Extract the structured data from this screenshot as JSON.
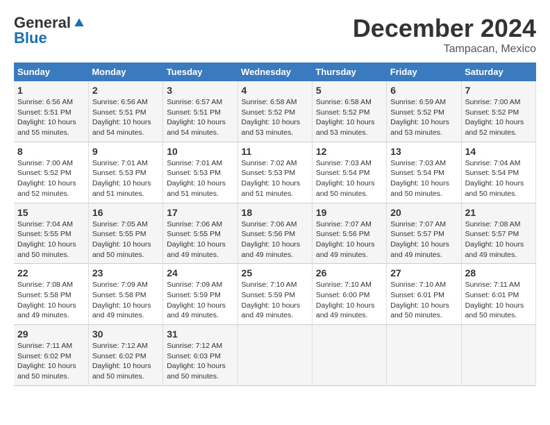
{
  "logo": {
    "general": "General",
    "blue": "Blue"
  },
  "title": {
    "month": "December 2024",
    "location": "Tampacan, Mexico"
  },
  "days_of_week": [
    "Sunday",
    "Monday",
    "Tuesday",
    "Wednesday",
    "Thursday",
    "Friday",
    "Saturday"
  ],
  "weeks": [
    [
      {
        "day": "1",
        "sunrise": "Sunrise: 6:56 AM",
        "sunset": "Sunset: 5:51 PM",
        "daylight": "Daylight: 10 hours and 55 minutes."
      },
      {
        "day": "2",
        "sunrise": "Sunrise: 6:56 AM",
        "sunset": "Sunset: 5:51 PM",
        "daylight": "Daylight: 10 hours and 54 minutes."
      },
      {
        "day": "3",
        "sunrise": "Sunrise: 6:57 AM",
        "sunset": "Sunset: 5:51 PM",
        "daylight": "Daylight: 10 hours and 54 minutes."
      },
      {
        "day": "4",
        "sunrise": "Sunrise: 6:58 AM",
        "sunset": "Sunset: 5:52 PM",
        "daylight": "Daylight: 10 hours and 53 minutes."
      },
      {
        "day": "5",
        "sunrise": "Sunrise: 6:58 AM",
        "sunset": "Sunset: 5:52 PM",
        "daylight": "Daylight: 10 hours and 53 minutes."
      },
      {
        "day": "6",
        "sunrise": "Sunrise: 6:59 AM",
        "sunset": "Sunset: 5:52 PM",
        "daylight": "Daylight: 10 hours and 53 minutes."
      },
      {
        "day": "7",
        "sunrise": "Sunrise: 7:00 AM",
        "sunset": "Sunset: 5:52 PM",
        "daylight": "Daylight: 10 hours and 52 minutes."
      }
    ],
    [
      {
        "day": "8",
        "sunrise": "Sunrise: 7:00 AM",
        "sunset": "Sunset: 5:52 PM",
        "daylight": "Daylight: 10 hours and 52 minutes."
      },
      {
        "day": "9",
        "sunrise": "Sunrise: 7:01 AM",
        "sunset": "Sunset: 5:53 PM",
        "daylight": "Daylight: 10 hours and 51 minutes."
      },
      {
        "day": "10",
        "sunrise": "Sunrise: 7:01 AM",
        "sunset": "Sunset: 5:53 PM",
        "daylight": "Daylight: 10 hours and 51 minutes."
      },
      {
        "day": "11",
        "sunrise": "Sunrise: 7:02 AM",
        "sunset": "Sunset: 5:53 PM",
        "daylight": "Daylight: 10 hours and 51 minutes."
      },
      {
        "day": "12",
        "sunrise": "Sunrise: 7:03 AM",
        "sunset": "Sunset: 5:54 PM",
        "daylight": "Daylight: 10 hours and 50 minutes."
      },
      {
        "day": "13",
        "sunrise": "Sunrise: 7:03 AM",
        "sunset": "Sunset: 5:54 PM",
        "daylight": "Daylight: 10 hours and 50 minutes."
      },
      {
        "day": "14",
        "sunrise": "Sunrise: 7:04 AM",
        "sunset": "Sunset: 5:54 PM",
        "daylight": "Daylight: 10 hours and 50 minutes."
      }
    ],
    [
      {
        "day": "15",
        "sunrise": "Sunrise: 7:04 AM",
        "sunset": "Sunset: 5:55 PM",
        "daylight": "Daylight: 10 hours and 50 minutes."
      },
      {
        "day": "16",
        "sunrise": "Sunrise: 7:05 AM",
        "sunset": "Sunset: 5:55 PM",
        "daylight": "Daylight: 10 hours and 50 minutes."
      },
      {
        "day": "17",
        "sunrise": "Sunrise: 7:06 AM",
        "sunset": "Sunset: 5:55 PM",
        "daylight": "Daylight: 10 hours and 49 minutes."
      },
      {
        "day": "18",
        "sunrise": "Sunrise: 7:06 AM",
        "sunset": "Sunset: 5:56 PM",
        "daylight": "Daylight: 10 hours and 49 minutes."
      },
      {
        "day": "19",
        "sunrise": "Sunrise: 7:07 AM",
        "sunset": "Sunset: 5:56 PM",
        "daylight": "Daylight: 10 hours and 49 minutes."
      },
      {
        "day": "20",
        "sunrise": "Sunrise: 7:07 AM",
        "sunset": "Sunset: 5:57 PM",
        "daylight": "Daylight: 10 hours and 49 minutes."
      },
      {
        "day": "21",
        "sunrise": "Sunrise: 7:08 AM",
        "sunset": "Sunset: 5:57 PM",
        "daylight": "Daylight: 10 hours and 49 minutes."
      }
    ],
    [
      {
        "day": "22",
        "sunrise": "Sunrise: 7:08 AM",
        "sunset": "Sunset: 5:58 PM",
        "daylight": "Daylight: 10 hours and 49 minutes."
      },
      {
        "day": "23",
        "sunrise": "Sunrise: 7:09 AM",
        "sunset": "Sunset: 5:58 PM",
        "daylight": "Daylight: 10 hours and 49 minutes."
      },
      {
        "day": "24",
        "sunrise": "Sunrise: 7:09 AM",
        "sunset": "Sunset: 5:59 PM",
        "daylight": "Daylight: 10 hours and 49 minutes."
      },
      {
        "day": "25",
        "sunrise": "Sunrise: 7:10 AM",
        "sunset": "Sunset: 5:59 PM",
        "daylight": "Daylight: 10 hours and 49 minutes."
      },
      {
        "day": "26",
        "sunrise": "Sunrise: 7:10 AM",
        "sunset": "Sunset: 6:00 PM",
        "daylight": "Daylight: 10 hours and 49 minutes."
      },
      {
        "day": "27",
        "sunrise": "Sunrise: 7:10 AM",
        "sunset": "Sunset: 6:01 PM",
        "daylight": "Daylight: 10 hours and 50 minutes."
      },
      {
        "day": "28",
        "sunrise": "Sunrise: 7:11 AM",
        "sunset": "Sunset: 6:01 PM",
        "daylight": "Daylight: 10 hours and 50 minutes."
      }
    ],
    [
      {
        "day": "29",
        "sunrise": "Sunrise: 7:11 AM",
        "sunset": "Sunset: 6:02 PM",
        "daylight": "Daylight: 10 hours and 50 minutes."
      },
      {
        "day": "30",
        "sunrise": "Sunrise: 7:12 AM",
        "sunset": "Sunset: 6:02 PM",
        "daylight": "Daylight: 10 hours and 50 minutes."
      },
      {
        "day": "31",
        "sunrise": "Sunrise: 7:12 AM",
        "sunset": "Sunset: 6:03 PM",
        "daylight": "Daylight: 10 hours and 50 minutes."
      },
      null,
      null,
      null,
      null
    ]
  ]
}
